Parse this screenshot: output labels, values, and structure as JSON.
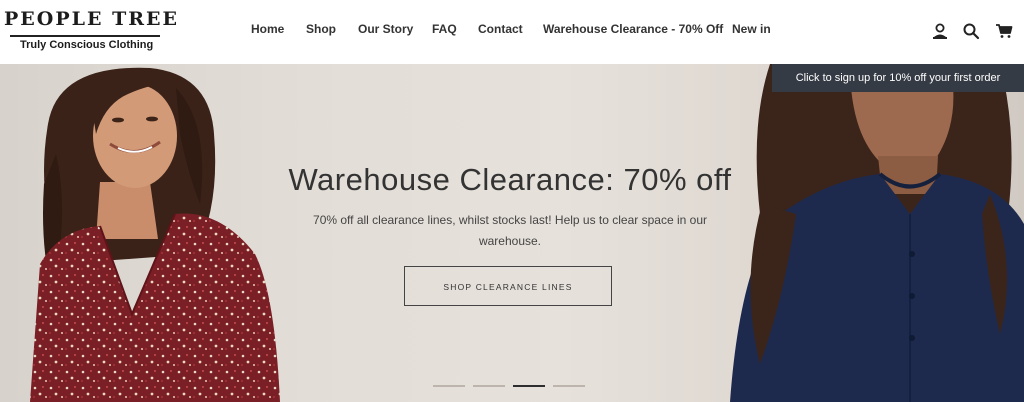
{
  "logo": {
    "brand": "PEOPLE TREE",
    "tagline": "Truly Conscious Clothing"
  },
  "nav": [
    "Home",
    "Shop",
    "Our Story",
    "FAQ",
    "Contact",
    "Warehouse Clearance - 70% Off",
    "New in"
  ],
  "header_icons": [
    "account-icon",
    "search-icon",
    "cart-icon"
  ],
  "signup_banner": "Click to sign up for 10% off your first order",
  "hero": {
    "title": "Warehouse Clearance: 70% off",
    "subtitle": "70% off all clearance lines, whilst stocks last! Help us to clear space in our warehouse.",
    "cta": "SHOP CLEARANCE LINES",
    "slides_count": 4,
    "active_slide": 3
  },
  "colors": {
    "banner_bg": "#353b45",
    "dress": "#7a1f25",
    "shirt": "#1e2a4d"
  }
}
